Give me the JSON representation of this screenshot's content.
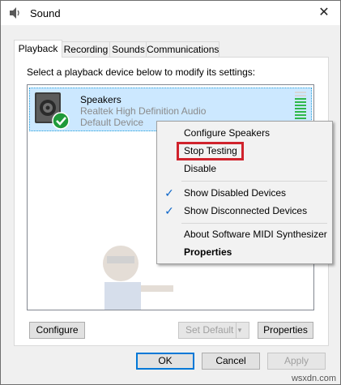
{
  "window": {
    "title": "Sound",
    "close_glyph": "✕"
  },
  "tabs": [
    {
      "label": "Playback",
      "active": true
    },
    {
      "label": "Recording",
      "active": false
    },
    {
      "label": "Sounds",
      "active": false
    },
    {
      "label": "Communications",
      "active": false
    }
  ],
  "panel": {
    "instruction": "Select a playback device below to modify its settings:"
  },
  "device": {
    "name": "Speakers",
    "driver": "Realtek High Definition Audio",
    "status": "Default Device",
    "icon": "speaker-icon",
    "status_icon": "green-check-icon",
    "level_fraction": 0.85
  },
  "context_menu": {
    "items": [
      {
        "label": "Configure Speakers",
        "checked": false,
        "bold": false
      },
      {
        "label": "Stop Testing",
        "checked": false,
        "bold": false,
        "highlighted": true
      },
      {
        "label": "Disable",
        "checked": false,
        "bold": false
      },
      {
        "label": "Show Disabled Devices",
        "checked": true,
        "bold": false
      },
      {
        "label": "Show Disconnected Devices",
        "checked": true,
        "bold": false
      },
      {
        "label": "About Software MIDI Synthesizer",
        "checked": false,
        "bold": false
      },
      {
        "label": "Properties",
        "checked": false,
        "bold": true
      }
    ]
  },
  "panel_buttons": {
    "configure": "Configure",
    "set_default": "Set Default",
    "properties": "Properties"
  },
  "dialog_buttons": {
    "ok": "OK",
    "cancel": "Cancel",
    "apply": "Apply"
  },
  "watermark_text": "wsxdn.com",
  "colors": {
    "selection": "#cce8ff",
    "highlight_border": "#d0232d",
    "check": "#0a64c8",
    "level_meter": "#2fb84a",
    "default_button_border": "#0078d7"
  }
}
